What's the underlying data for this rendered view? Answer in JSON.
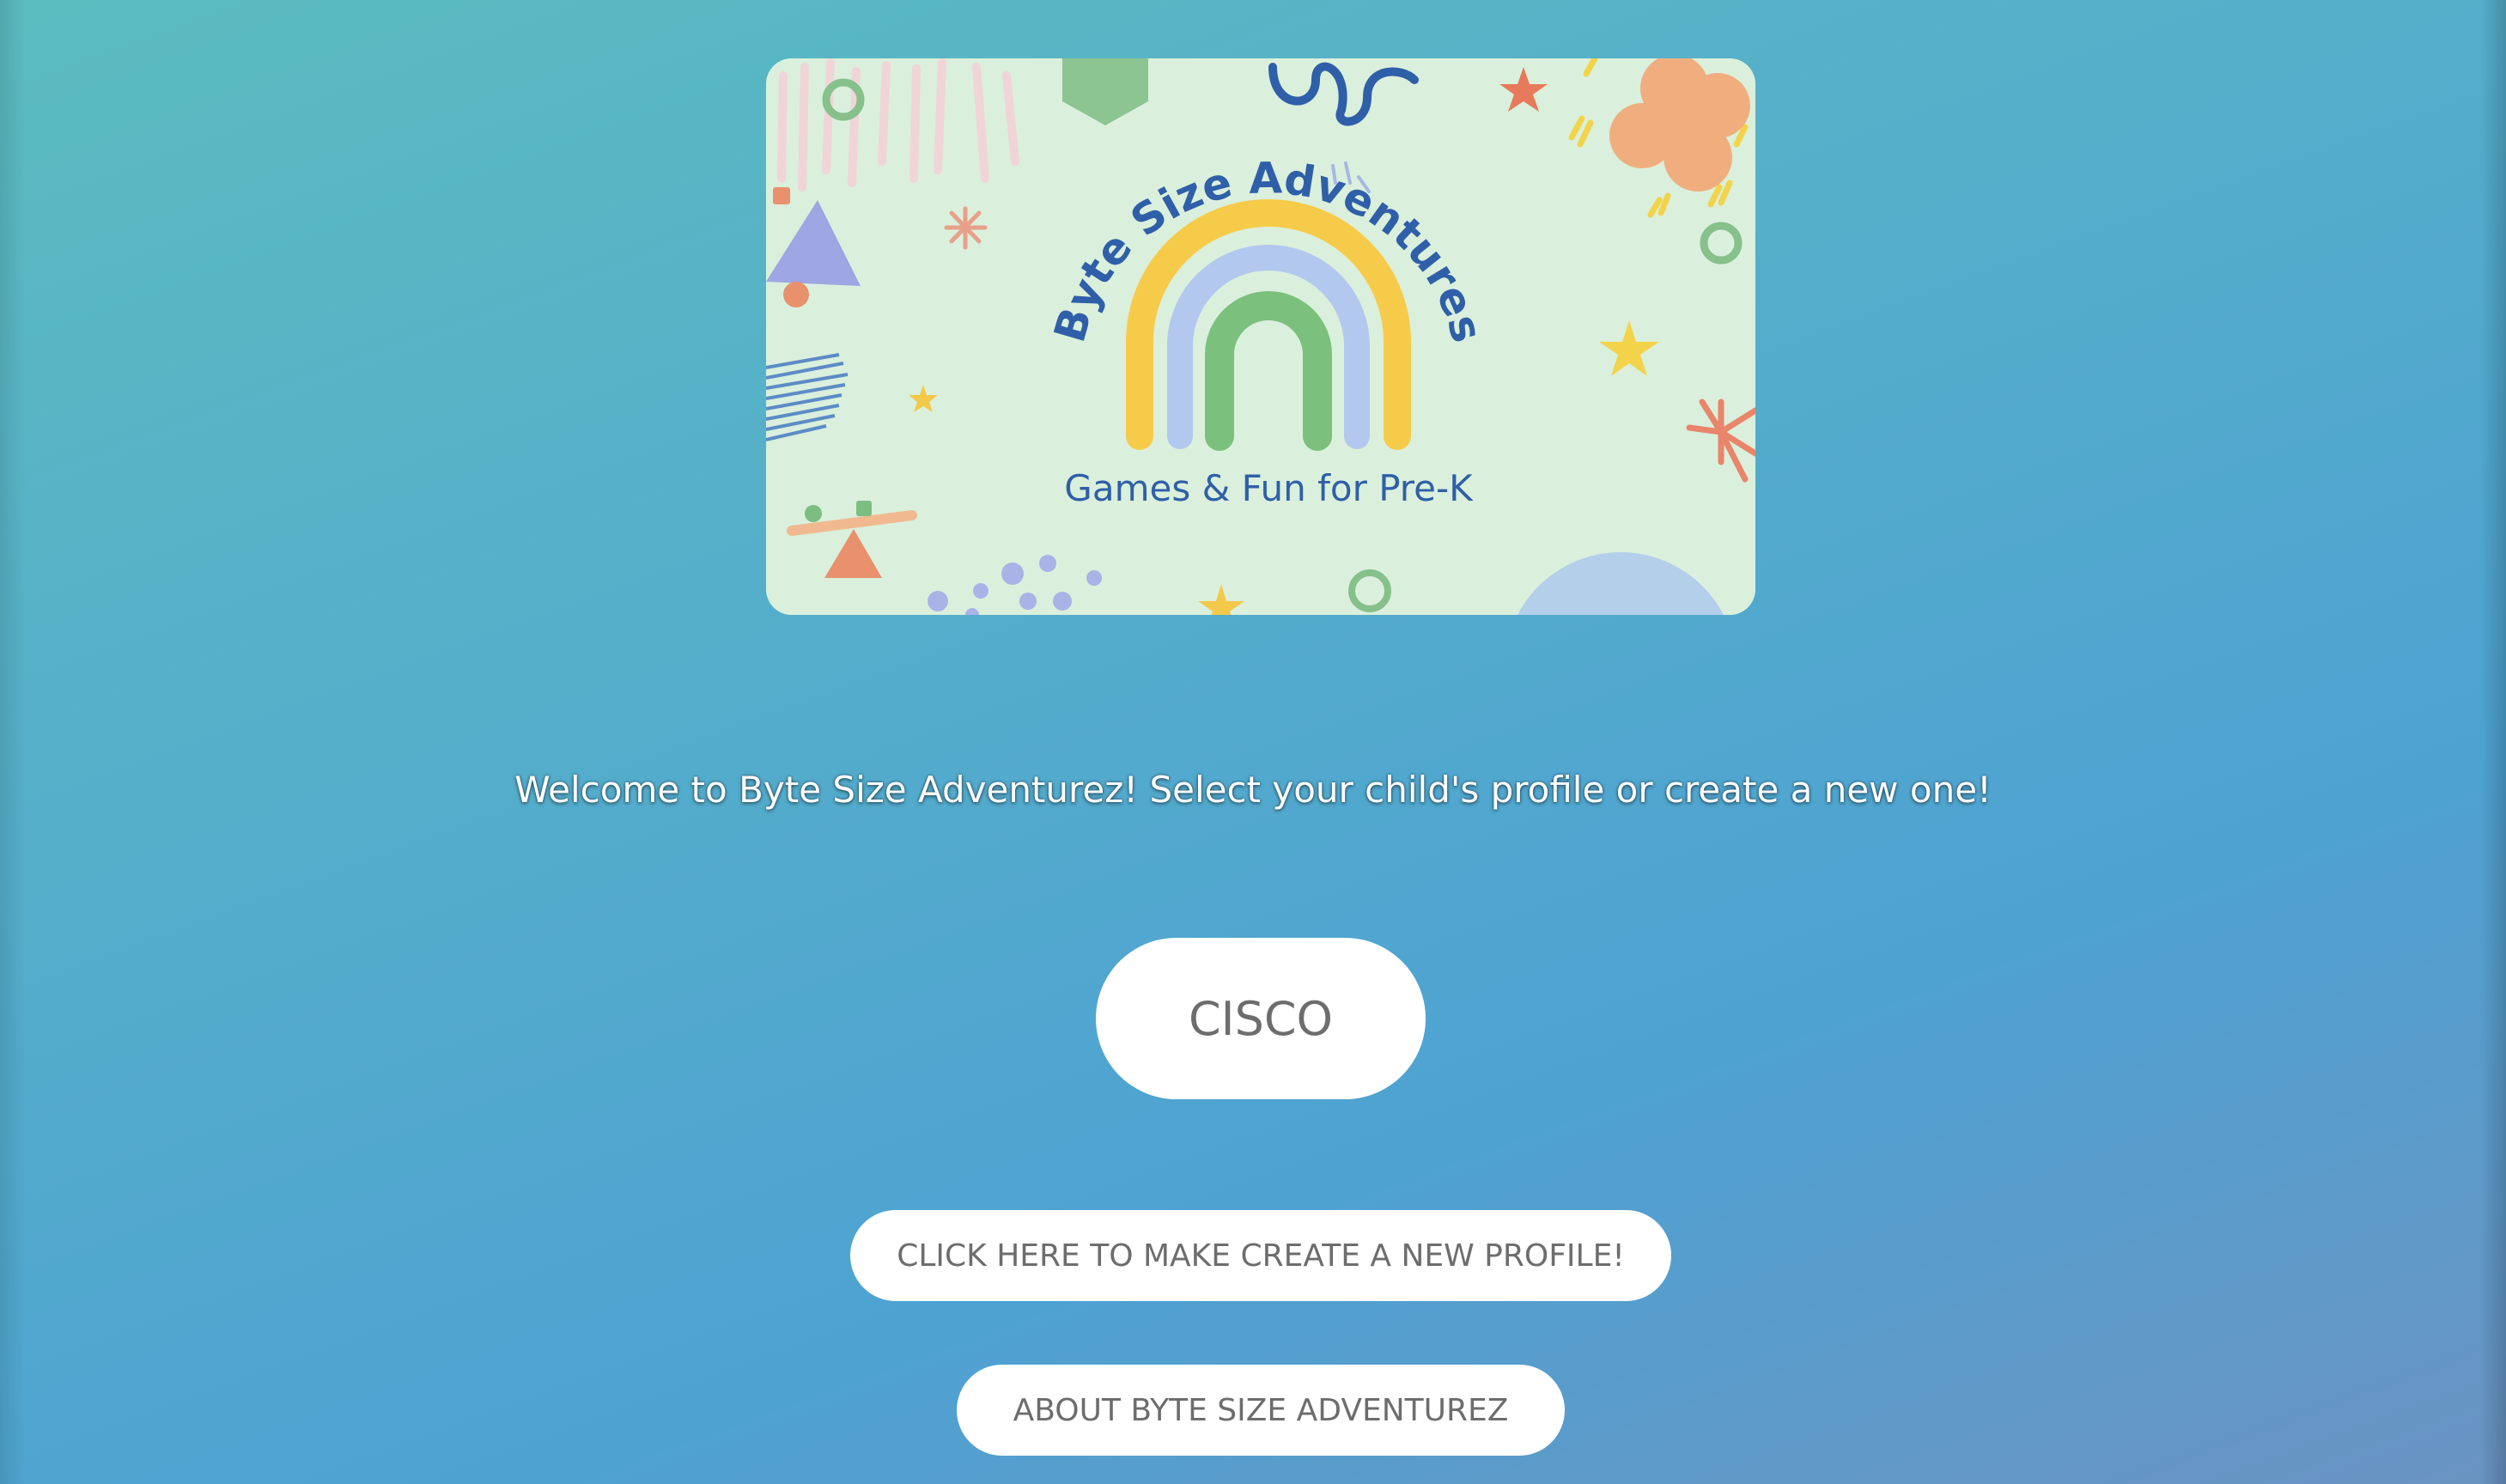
{
  "banner": {
    "logo_title": "Byte Size Adventures",
    "logo_tagline": "Games & Fun for Pre-K"
  },
  "welcome": {
    "text": "Welcome to Byte Size Adventurez! Select your child's profile or create a new one!"
  },
  "profiles": [
    {
      "label": "CISCO"
    }
  ],
  "actions": {
    "create_label": "CLICK HERE TO MAKE CREATE A NEW PROFILE!",
    "about_label": "ABOUT BYTE SIZE ADVENTUREZ"
  },
  "colors": {
    "bg_start": "#5bbcbf",
    "bg_end": "#4ea2d2",
    "banner_bg": "#daf0dc",
    "logo_blue": "#2f5fa8",
    "rainbow_yellow": "#f7cb4a",
    "rainbow_lightblue": "#b3c8ee",
    "rainbow_green": "#7cc07e",
    "button_bg": "#ffffff",
    "button_text": "#6d6d6d"
  }
}
